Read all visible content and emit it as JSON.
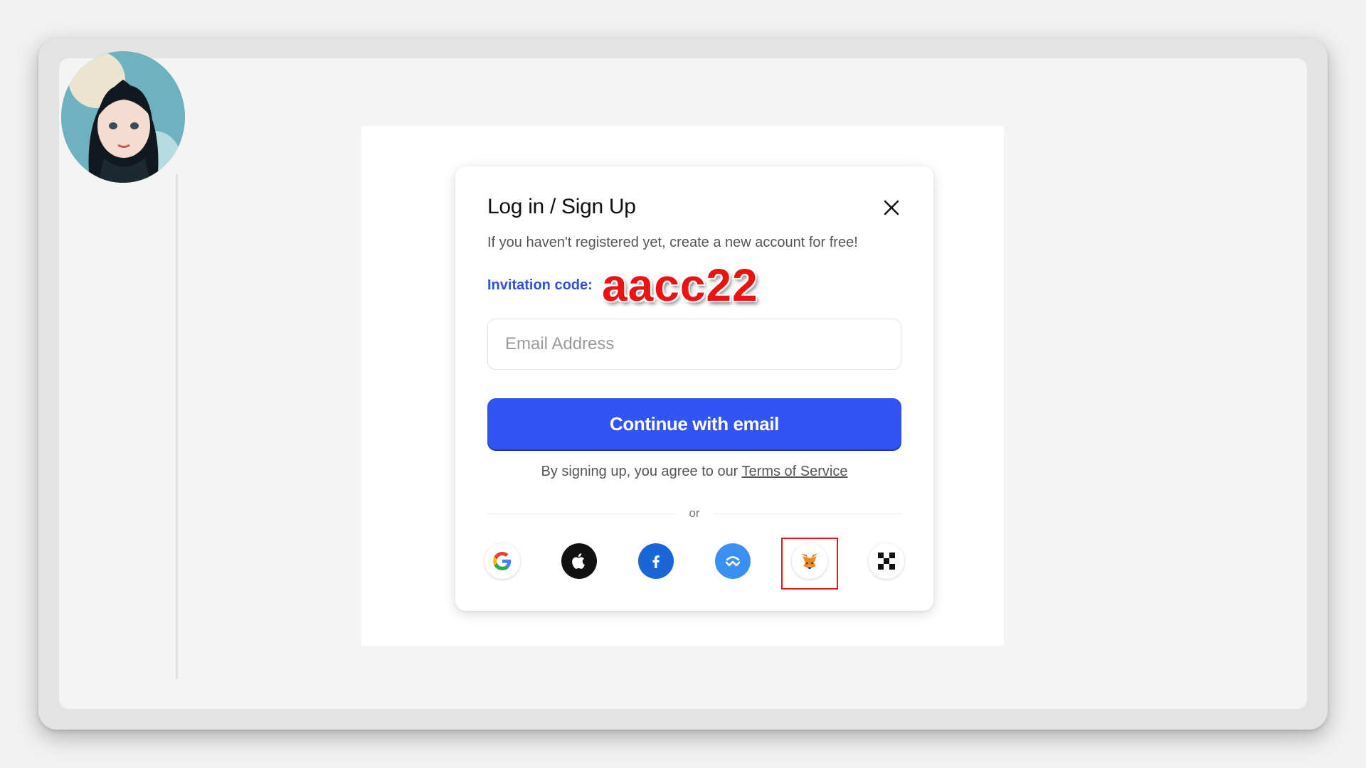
{
  "dialog": {
    "title": "Log in / Sign Up",
    "subtitle": "If you haven't registered yet, create a new account for free!",
    "invitation_label": "Invitation code:",
    "invitation_code": "aacc22",
    "email_placeholder": "Email Address",
    "continue_label": "Continue with email",
    "terms_prefix": "By signing up, you agree to our ",
    "terms_link": "Terms of Service",
    "or_text": "or"
  },
  "social": [
    {
      "name": "google-icon",
      "bg": "#ffffff"
    },
    {
      "name": "apple-icon",
      "bg": "#111111"
    },
    {
      "name": "facebook-icon",
      "bg": "#1877f2"
    },
    {
      "name": "wallet-connect-icon",
      "bg": "#3b99fc"
    },
    {
      "name": "metamask-icon",
      "bg": "#ffffff",
      "highlighted": true
    },
    {
      "name": "qr-code-icon",
      "bg": "#ffffff"
    }
  ],
  "colors": {
    "accent": "#3354f4",
    "invitation_label": "#2d51d9",
    "invitation_code": "#ee1111",
    "highlight": "#e8141c"
  }
}
